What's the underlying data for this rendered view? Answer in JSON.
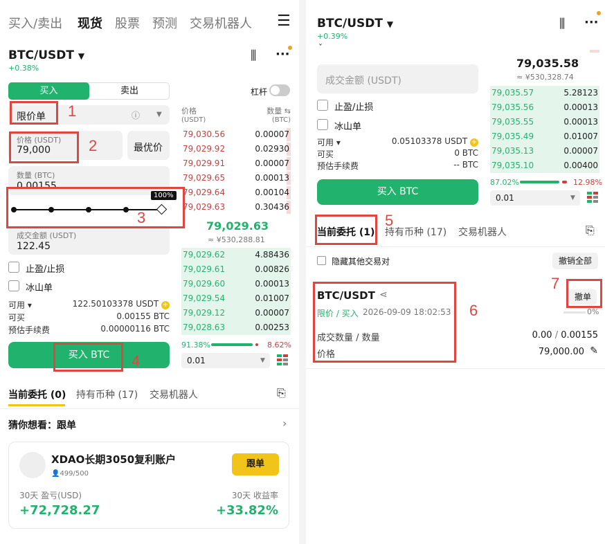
{
  "left": {
    "top_tabs": [
      "买入/卖出",
      "现货",
      "股票",
      "预测",
      "交易机器人"
    ],
    "pair": "BTC/USDT",
    "change": "+0.38%",
    "buy_tab": "买入",
    "sell_tab": "卖出",
    "leverage": "杠杆",
    "order_type": "限价单",
    "price_label": "价格 (USDT)",
    "price_value": "79,000",
    "best_price": "最优价",
    "qty_label": "数量 (BTC)",
    "qty_value": "0.00155",
    "slider_pct": "100%",
    "slider_level": 1.0,
    "amount_label": "成交金额 (USDT)",
    "amount_value": "122.45",
    "tp_sl": "止盈/止损",
    "iceberg": "冰山单",
    "info": [
      {
        "k": "可用 ▾",
        "v": "122.50103378 USDT"
      },
      {
        "k": "可买",
        "v": "0.00155 BTC"
      },
      {
        "k": "预估手续费",
        "v": "0.00000116 BTC"
      }
    ],
    "buy_button": "买入 BTC",
    "bottom_tabs": [
      "当前委托 (0)",
      "持有币种 (17)",
      "交易机器人"
    ],
    "guess": "猜你想看：跟单",
    "card": {
      "name": "XDAO长期3050复利账户",
      "followers": "499/500",
      "follow_btn": "跟单",
      "l1": "30天 盈亏(USD)",
      "v1": "+72,728.27",
      "l2": "30天 收益率",
      "v2": "+33.82%"
    }
  },
  "book": {
    "h_price": "价格",
    "h_price_unit": "(USDT)",
    "h_qty": "数量 ⇆",
    "h_qty_unit": "(BTC)",
    "asks": [
      [
        "79,030.56",
        "0.00007"
      ],
      [
        "79,029.92",
        "0.02930"
      ],
      [
        "79,029.91",
        "0.00007"
      ],
      [
        "79,029.65",
        "0.00013"
      ],
      [
        "79,029.64",
        "0.00104"
      ],
      [
        "79,029.63",
        "0.30436"
      ]
    ],
    "mid": "79,029.63",
    "mid_cny": "≈ ¥530,288.81",
    "bids": [
      [
        "79,029.62",
        "4.88436"
      ],
      [
        "79,029.61",
        "0.00826"
      ],
      [
        "79,029.60",
        "0.00013"
      ],
      [
        "79,029.54",
        "0.01007"
      ],
      [
        "79,029.12",
        "0.00007"
      ],
      [
        "79,028.63",
        "0.00253"
      ]
    ],
    "buy_pct": "91.38%",
    "sell_pct": "8.62%",
    "buy_ratio": 0.9138,
    "tick": "0.01"
  },
  "right": {
    "pair": "BTC/USDT",
    "change": "+0.39%",
    "amount_placeholder": "成交金额 (USDT)",
    "tp_sl": "止盈/止损",
    "iceberg": "冰山单",
    "info": [
      {
        "k": "可用 ▾",
        "v": "0.05103378 USDT"
      },
      {
        "k": "可买",
        "v": "0 BTC"
      },
      {
        "k": "预估手续费",
        "v": "-- BTC"
      }
    ],
    "buy_button": "买入 BTC",
    "book_mid": "79,035.58",
    "book_cny": "≈ ¥530,328.74",
    "bids": [
      [
        "79,035.57",
        "5.28123"
      ],
      [
        "79,035.56",
        "0.00013"
      ],
      [
        "79,035.55",
        "0.00013"
      ],
      [
        "79,035.49",
        "0.01007"
      ],
      [
        "79,035.13",
        "0.00007"
      ],
      [
        "79,035.10",
        "0.00400"
      ]
    ],
    "buy_pct": "87.02%",
    "sell_pct": "12.98%",
    "buy_ratio": 0.8702,
    "tick": "0.01",
    "tabs": [
      "当前委托 (1)",
      "持有币种 (17)",
      "交易机器人"
    ],
    "hide_others": "隐藏其他交易对",
    "cancel_all": "撤销全部",
    "order": {
      "pair": "BTC/USDT",
      "type": "限价 / 买入",
      "time": "2026-09-09 18:02:53",
      "cancel": "撤单",
      "progress": "0%",
      "filled_label": "成交数量 / 数量",
      "filled_a": "0.00",
      "filled_sep": " / ",
      "filled_b": "0.00155",
      "price_label": "价格",
      "price": "79,000.00"
    }
  },
  "annotations": [
    "1",
    "2",
    "3",
    "4",
    "5",
    "6",
    "7"
  ],
  "colors": {
    "green": "#21b36d",
    "red": "#c9403f",
    "accent": "#e0463f",
    "yellow": "#f0c419"
  }
}
